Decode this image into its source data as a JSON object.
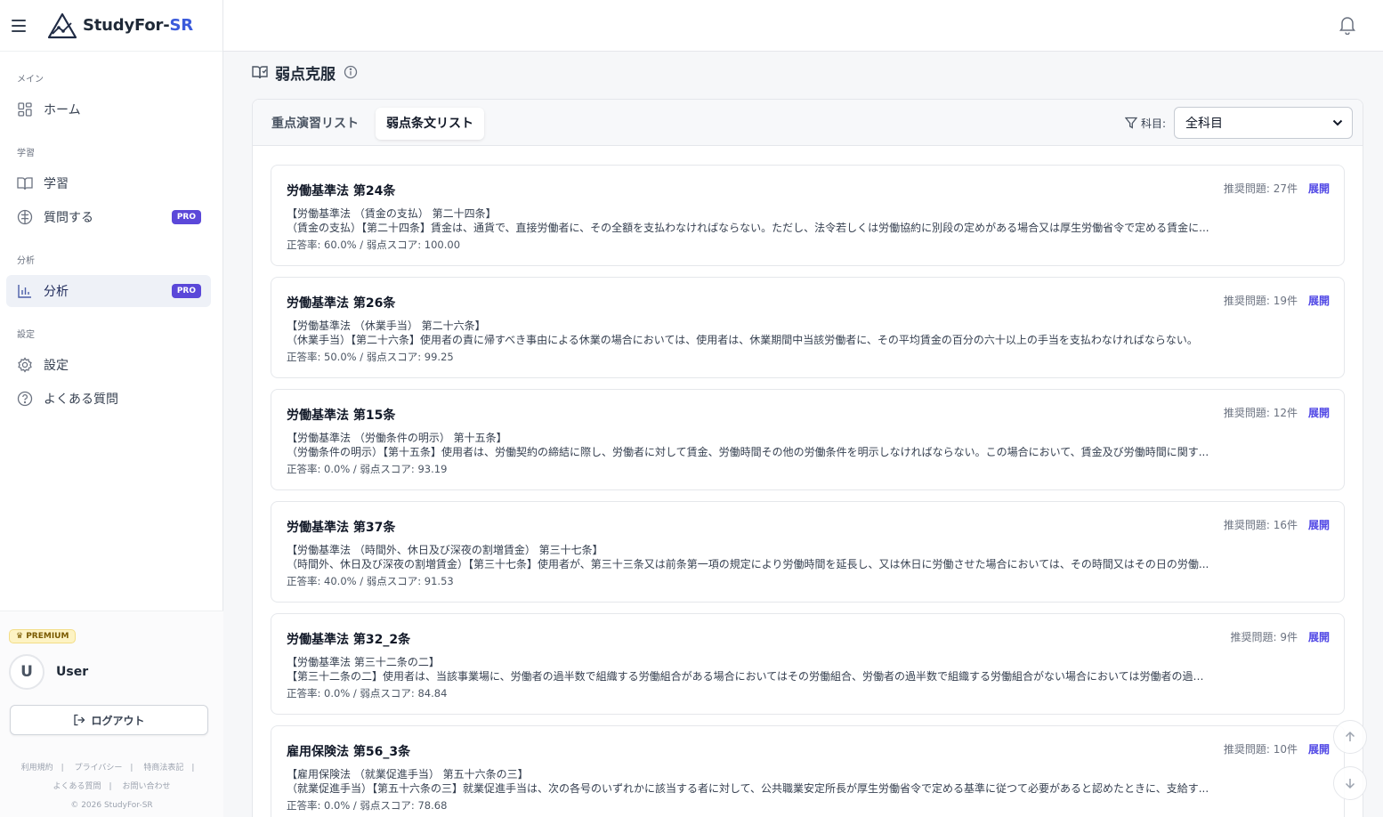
{
  "brand": {
    "name_main": "StudyFor-",
    "name_accent": "SR"
  },
  "sidebar": {
    "sections": [
      {
        "label": "メイン",
        "items": [
          {
            "label": "ホーム",
            "icon": "grid-icon"
          }
        ]
      },
      {
        "label": "学習",
        "items": [
          {
            "label": "学習",
            "icon": "book-icon"
          },
          {
            "label": "質問する",
            "icon": "brain-icon",
            "badge": "PRO"
          }
        ]
      },
      {
        "label": "分析",
        "items": [
          {
            "label": "分析",
            "icon": "bar-chart-icon",
            "badge": "PRO",
            "active": true
          }
        ]
      },
      {
        "label": "設定",
        "items": [
          {
            "label": "設定",
            "icon": "gear-icon"
          },
          {
            "label": "よくある質問",
            "icon": "help-circle-icon"
          }
        ]
      }
    ],
    "premium_label": "PREMIUM",
    "avatar_initial": "U",
    "username": "User",
    "logout_label": "ログアウト",
    "footer_links": [
      "利用規約",
      "プライバシー",
      "特商法表記",
      "よくある質問",
      "お問い合わせ"
    ],
    "copyright": "© 2026 StudyFor-SR"
  },
  "page": {
    "title": "弱点克服",
    "tabs": [
      {
        "label": "重点演習リスト",
        "active": false
      },
      {
        "label": "弱点条文リスト",
        "active": true
      }
    ],
    "filter_label": "科目:",
    "filter_value": "全科目",
    "expand_label": "展開"
  },
  "cards": [
    {
      "title": "労働基準法 第24条",
      "recommended": "推奨問題: 27件",
      "line1": "【労働基準法 （賃金の支払） 第二十四条】",
      "line2": "（賃金の支払）【第二十四条】賃金は、通貨で、直接労働者に、その全額を支払わなければならない。ただし、法令若しくは労働協約に別段の定めがある場合又は厚生労働省令で定める賃金に...",
      "score": "正答率: 60.0% / 弱点スコア: 100.00"
    },
    {
      "title": "労働基準法 第26条",
      "recommended": "推奨問題: 19件",
      "line1": "【労働基準法 （休業手当） 第二十六条】",
      "line2": "（休業手当）【第二十六条】使用者の責に帰すべき事由による休業の場合においては、使用者は、休業期間中当該労働者に、その平均賃金の百分の六十以上の手当を支払わなければならない。",
      "score": "正答率: 50.0% / 弱点スコア: 99.25"
    },
    {
      "title": "労働基準法 第15条",
      "recommended": "推奨問題: 12件",
      "line1": "【労働基準法 （労働条件の明示） 第十五条】",
      "line2": "（労働条件の明示）【第十五条】使用者は、労働契約の締結に際し、労働者に対して賃金、労働時間その他の労働条件を明示しなければならない。この場合において、賃金及び労働時間に関す...",
      "score": "正答率: 0.0% / 弱点スコア: 93.19"
    },
    {
      "title": "労働基準法 第37条",
      "recommended": "推奨問題: 16件",
      "line1": "【労働基準法 （時間外、休日及び深夜の割増賃金） 第三十七条】",
      "line2": "（時間外、休日及び深夜の割増賃金）【第三十七条】使用者が、第三十三条又は前条第一項の規定により労働時間を延長し、又は休日に労働させた場合においては、その時間又はその日の労働...",
      "score": "正答率: 40.0% / 弱点スコア: 91.53"
    },
    {
      "title": "労働基準法 第32_2条",
      "recommended": "推奨問題: 9件",
      "line1": "【労働基準法 第三十二条の二】",
      "line2": "【第三十二条の二】使用者は、当該事業場に、労働者の過半数で組織する労働組合がある場合においてはその労働組合、労働者の過半数で組織する労働組合がない場合においては労働者の過半...",
      "score": "正答率: 0.0% / 弱点スコア: 84.84"
    },
    {
      "title": "雇用保険法 第56_3条",
      "recommended": "推奨問題: 10件",
      "line1": "【雇用保険法 （就業促進手当） 第五十六条の三】",
      "line2": "（就業促進手当）【第五十六条の三】就業促進手当は、次の各号のいずれかに該当する者に対して、公共職業安定所長が厚生労働省令で定める基準に従つて必要があると認めたときに、支給す...",
      "score": "正答率: 0.0% / 弱点スコア: 78.68"
    }
  ]
}
